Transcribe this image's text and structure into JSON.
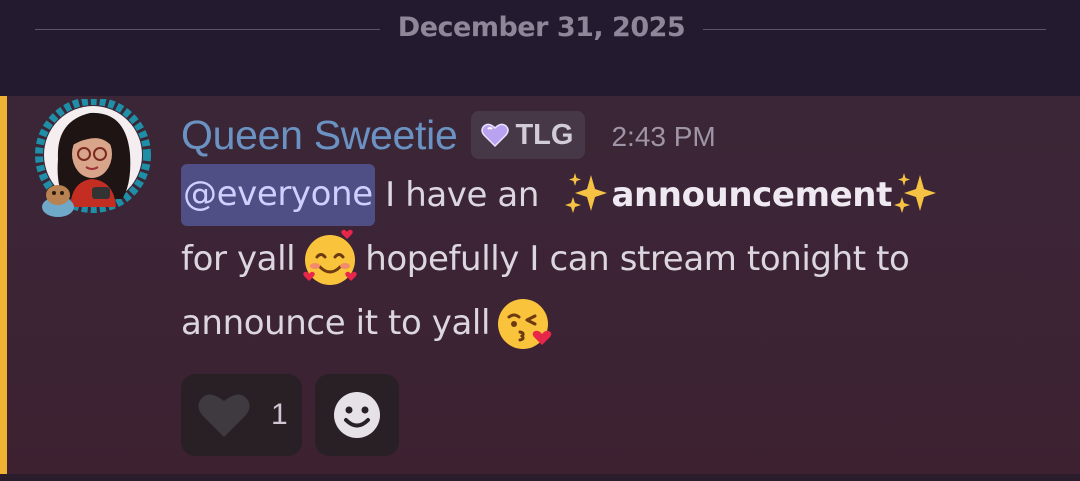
{
  "date_divider": {
    "label": "December 31, 2025"
  },
  "message": {
    "author": "Queen Sweetie",
    "tag": {
      "label": "TLG",
      "icon": "purple-heart-icon"
    },
    "timestamp": "2:43 PM",
    "content": {
      "mention": "@everyone",
      "text_1": "I have an",
      "bold": "announcement",
      "text_2": "for yall",
      "text_3": "hopefully I can stream tonight to",
      "text_4": "announce it to yall",
      "emojis": [
        "sparkles",
        "sparkles",
        "smiling-face-with-hearts",
        "face-blowing-a-kiss"
      ]
    },
    "reactions": [
      {
        "icon": "heart-icon",
        "count": "1"
      },
      {
        "icon": "add-reaction-icon",
        "count": ""
      }
    ]
  },
  "colors": {
    "background": "#261b30",
    "mention_bar": "#f0b232",
    "author": "#6a93c4",
    "mention_bg": "#4f4e85"
  }
}
